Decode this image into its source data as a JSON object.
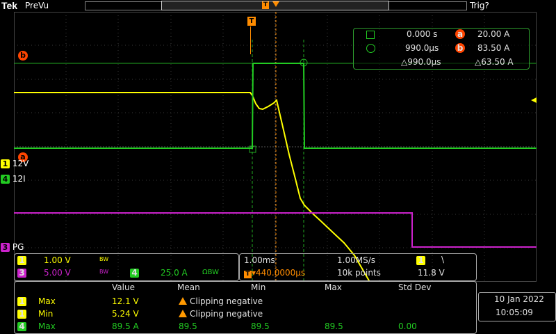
{
  "header": {
    "brand": "Tek",
    "acq_mode": "PreVu",
    "trigger_status": "Trig?"
  },
  "trigger": {
    "marker": "T"
  },
  "channels": [
    {
      "num": "1",
      "label": "12V",
      "color": "#ffff00"
    },
    {
      "num": "4",
      "label": "12I",
      "color": "#22cc22"
    },
    {
      "num": "3",
      "label": "PG",
      "color": "#cc22cc"
    }
  ],
  "cursors": {
    "a_label": "a",
    "b_label": "b",
    "t1": "0.000 s",
    "t2": "990.0µs",
    "dt": "△990.0µs",
    "a_val": "20.00 A",
    "b_val": "83.50 A",
    "dv": "△63.50 A"
  },
  "settings": {
    "ch1_num": "1",
    "ch1_scale": "1.00 V",
    "ch1_bw": "BW",
    "ch3_num": "3",
    "ch3_scale": "5.00 V",
    "ch3_bw": "BW",
    "ch4_num": "4",
    "ch4_scale": "25.0 A",
    "ch4_bw": "ΩBW"
  },
  "timebase": {
    "horiz_scale": "1.00ms",
    "sample_rate": "1.00MS/s",
    "position": "▾440.0000µs",
    "record_length": "10k points",
    "trig_source": "1",
    "trig_slope": "\\",
    "trig_level": "11.8 V"
  },
  "measurements": {
    "headers": [
      "Value",
      "Mean",
      "Min",
      "Max",
      "Std Dev"
    ],
    "rows": [
      {
        "ch": "1",
        "name": "Max",
        "value": "12.1 V",
        "mean": "Clipping negative",
        "min": "",
        "max": "",
        "std": ""
      },
      {
        "ch": "1",
        "name": "Min",
        "value": "5.24 V",
        "mean": "Clipping negative",
        "min": "",
        "max": "",
        "std": ""
      },
      {
        "ch": "4",
        "name": "Max",
        "value": "89.5 A",
        "mean": "89.5",
        "min": "89.5",
        "max": "89.5",
        "std": "0.00"
      }
    ]
  },
  "datetime": {
    "date": "10 Jan  2022",
    "time": "10:05:09"
  }
}
